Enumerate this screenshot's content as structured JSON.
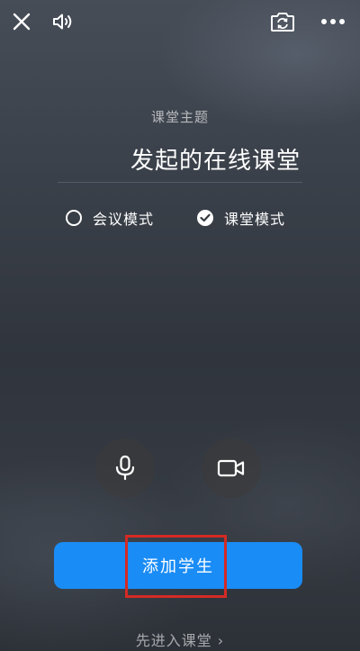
{
  "header": {
    "close_icon": "close-icon",
    "speaker_icon": "speaker-icon",
    "camera_switch_icon": "camera-switch-icon",
    "more_icon": "more-icon"
  },
  "topic": {
    "subtitle": "课堂主题",
    "value": "发起的在线课堂"
  },
  "modes": [
    {
      "label": "会议模式",
      "selected": false
    },
    {
      "label": "课堂模式",
      "selected": true
    }
  ],
  "controls": {
    "mic_icon": "microphone-icon",
    "camera_icon": "video-camera-icon"
  },
  "actions": {
    "add_students": "添加学生",
    "enter_first": "先进入课堂",
    "enter_chevron": "›"
  },
  "colors": {
    "accent": "#1a8cf5",
    "highlight": "#d42a24"
  }
}
